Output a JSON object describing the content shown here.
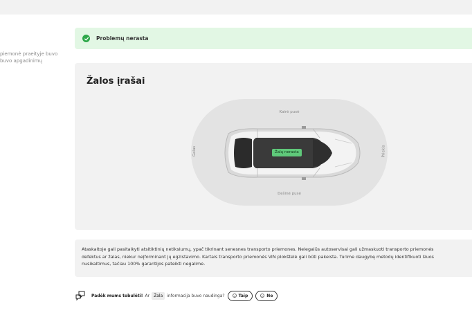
{
  "sidebar_text": [
    "piemonė praeityje buvo",
    "buvo apgadinimų"
  ],
  "status": {
    "text": "Problemų nerasta",
    "color": "#2ea84a"
  },
  "damage": {
    "title": "Žalos įrašai",
    "labels": {
      "top": "Kairė pusė",
      "bottom": "Dešinė pusė",
      "left": "Galas",
      "right": "Priekis"
    },
    "badge": "Žalų nerasta"
  },
  "disclaimer_lines": [
    "Ataskaitoje gali pasitaikyti atsitiktinių netikslumų, ypač tikrinant senesnes transporto priemones. Nelegalūs autoservisai gali užmaskuoti transporto priemonės",
    "defektus ar žalas, niekur neįforminant jų egzistavimo. Kartais transporto priemonės VIN plokštelė gali būti pakeista. Turime daugybę metodų identifikuoti šiuos",
    "nusikaltimus, tačiau 100% garantijos pateikti negalime."
  ],
  "feedback": {
    "strong": "Padėk mums tobulėti!",
    "ar": "Ar",
    "chip": "Žala",
    "question": "informacija buvo naudinga?",
    "yes": "Taip",
    "no": "Ne"
  }
}
